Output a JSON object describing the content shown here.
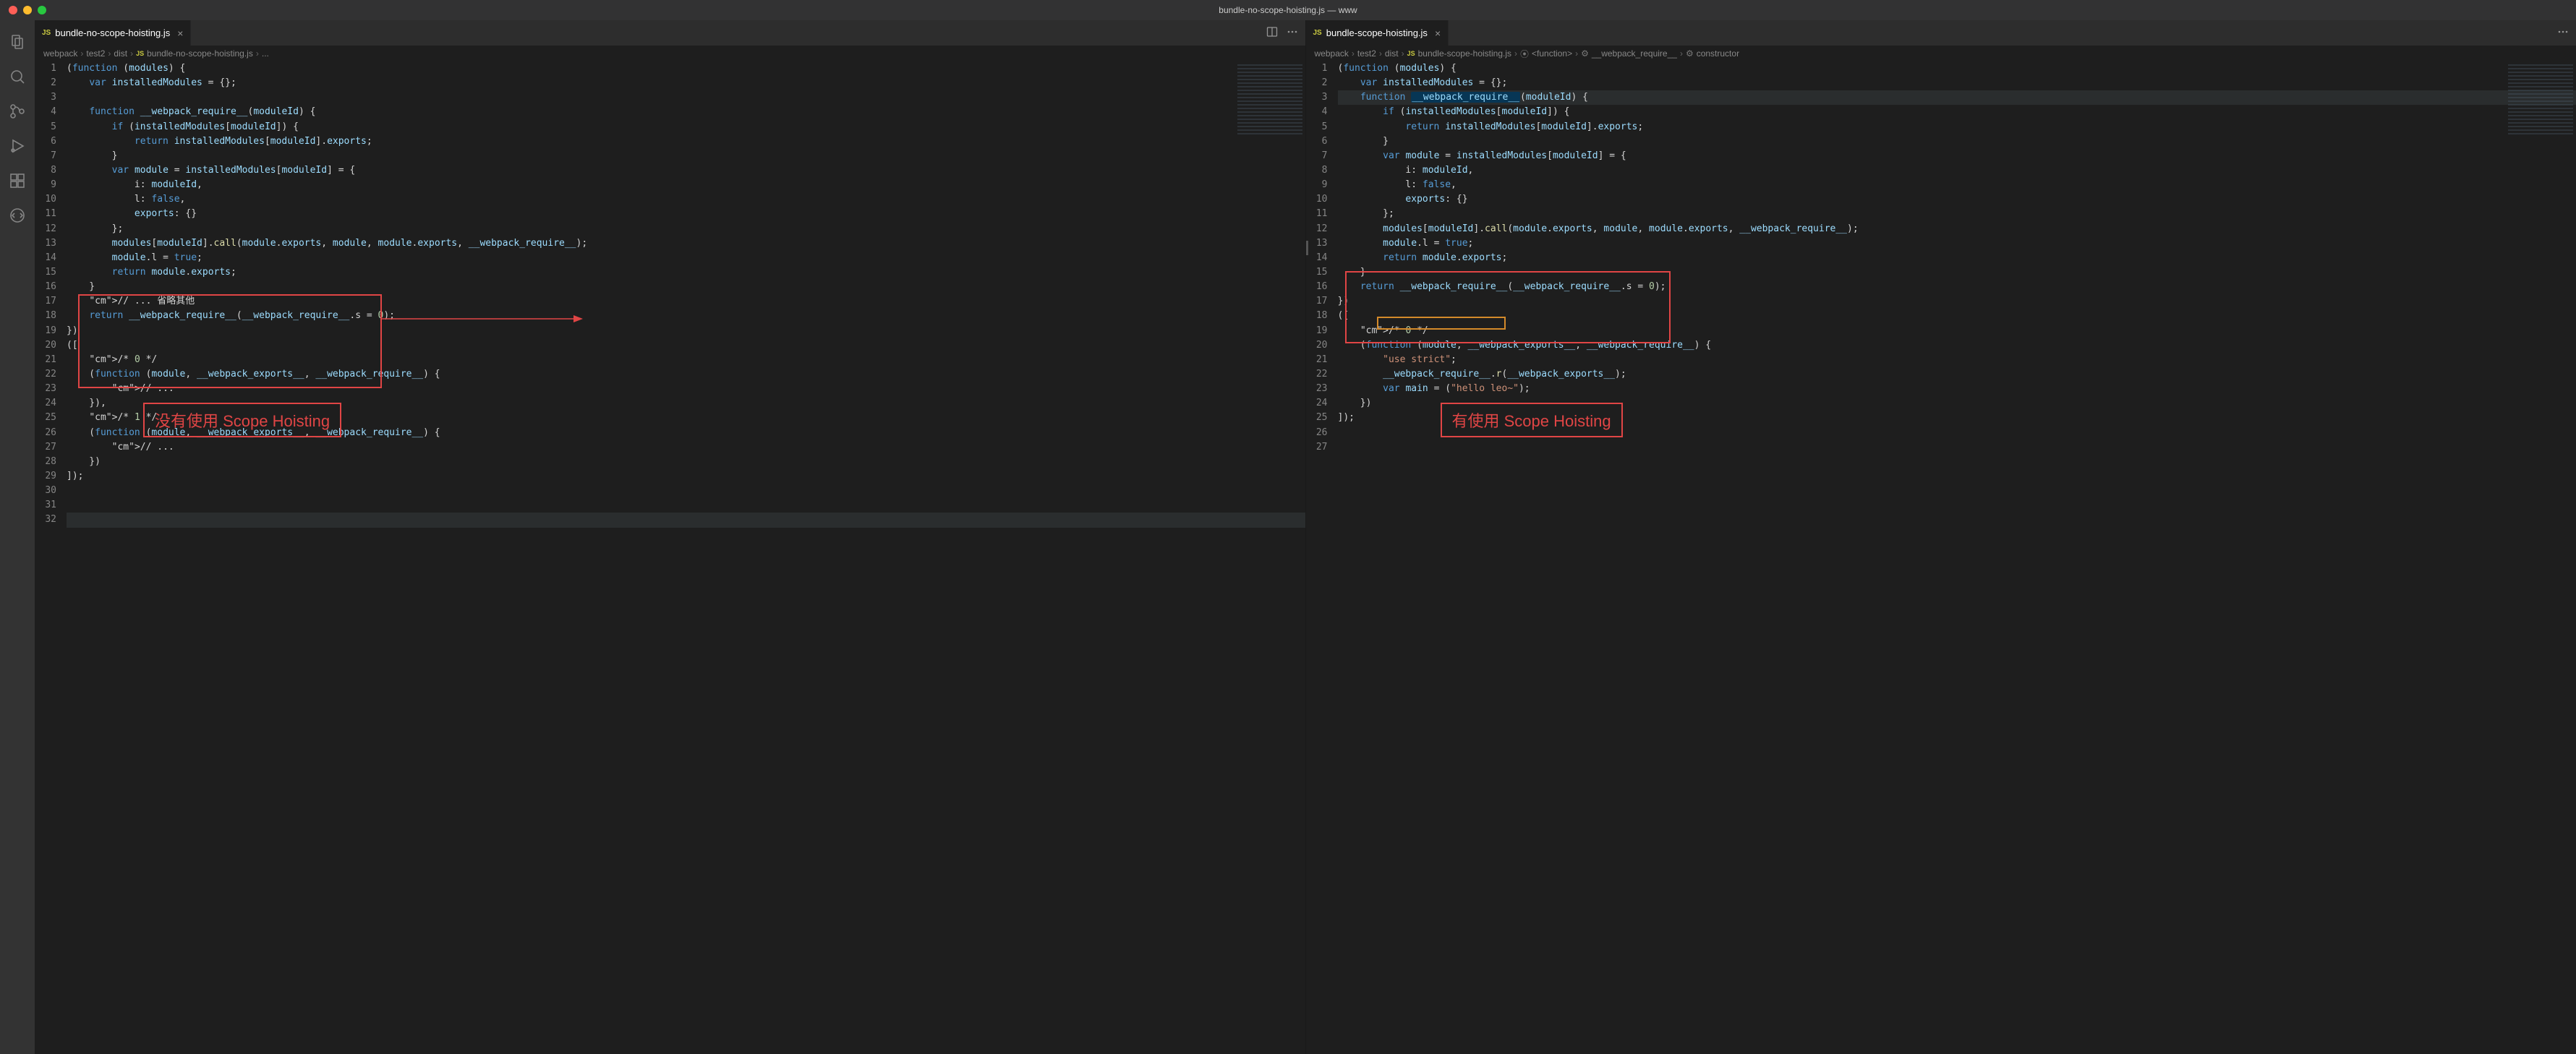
{
  "window": {
    "title": "bundle-no-scope-hoisting.js — www"
  },
  "activitybar": {
    "items": [
      {
        "name": "explorer-icon"
      },
      {
        "name": "search-icon"
      },
      {
        "name": "source-control-icon"
      },
      {
        "name": "debug-icon"
      },
      {
        "name": "extensions-icon"
      },
      {
        "name": "live-share-icon"
      }
    ]
  },
  "left": {
    "tab_label": "bundle-no-scope-hoisting.js",
    "breadcrumbs": [
      "webpack",
      "test2",
      "dist",
      "bundle-no-scope-hoisting.js",
      "..."
    ],
    "line_numbers": [
      "1",
      "2",
      "3",
      "4",
      "5",
      "6",
      "7",
      "8",
      "9",
      "10",
      "11",
      "12",
      "13",
      "14",
      "15",
      "16",
      "17",
      "18",
      "19",
      "20",
      "21",
      "22",
      "23",
      "24",
      "25",
      "26",
      "27",
      "28",
      "29",
      "30",
      "31",
      "32"
    ],
    "lines": {
      "l1": "(function (modules) {",
      "l2": "    var installedModules = {};",
      "l3": "",
      "l4": "    function __webpack_require__(moduleId) {",
      "l5": "        if (installedModules[moduleId]) {",
      "l6": "            return installedModules[moduleId].exports;",
      "l7": "        }",
      "l8": "        var module = installedModules[moduleId] = {",
      "l9": "            i: moduleId,",
      "l10": "            l: false,",
      "l11": "            exports: {}",
      "l12": "        };",
      "l13": "        modules[moduleId].call(module.exports, module, module.exports, __webpack_require__);",
      "l14": "        module.l = true;",
      "l15": "        return module.exports;",
      "l16": "    }",
      "l17": "    // ... 省略其他",
      "l18": "    return __webpack_require__(__webpack_require__.s = 0);",
      "l19": "})",
      "l20": "([",
      "l21": "    /* 0 */",
      "l22": "    (function (module, __webpack_exports__, __webpack_require__) {",
      "l23": "        // ...",
      "l24": "    }),",
      "l25": "    /* 1 */",
      "l26": "    (function (module, __webpack_exports__, __webpack_require__) {",
      "l27": "        // ...",
      "l28": "    })",
      "l29": "]);",
      "l30": "",
      "l31": "",
      "l32": ""
    },
    "annotation_label": "没有使用 Scope Hoisting"
  },
  "right": {
    "tab_label": "bundle-scope-hoisting.js",
    "breadcrumbs": [
      "webpack",
      "test2",
      "dist",
      "bundle-scope-hoisting.js",
      "<function>",
      "__webpack_require__",
      "constructor"
    ],
    "line_numbers": [
      "1",
      "2",
      "3",
      "4",
      "5",
      "6",
      "7",
      "8",
      "9",
      "10",
      "11",
      "12",
      "13",
      "14",
      "15",
      "16",
      "17",
      "18",
      "19",
      "20",
      "21",
      "22",
      "23",
      "24",
      "25",
      "26",
      "27"
    ],
    "lines": {
      "l1": "(function (modules) {",
      "l2": "    var installedModules = {};",
      "l3": "    function __webpack_require__(moduleId) {",
      "l4": "        if (installedModules[moduleId]) {",
      "l5": "            return installedModules[moduleId].exports;",
      "l6": "        }",
      "l7": "        var module = installedModules[moduleId] = {",
      "l8": "            i: moduleId,",
      "l9": "            l: false,",
      "l10": "            exports: {}",
      "l11": "        };",
      "l12": "        modules[moduleId].call(module.exports, module, module.exports, __webpack_require__);",
      "l13": "        module.l = true;",
      "l14": "        return module.exports;",
      "l15": "    }",
      "l16": "    return __webpack_require__(__webpack_require__.s = 0);",
      "l17": "})",
      "l18": "([",
      "l19": "    /* 0 */",
      "l20": "    (function (module, __webpack_exports__, __webpack_require__) {",
      "l21": "        \"use strict\";",
      "l22": "        __webpack_require__.r(__webpack_exports__);",
      "l23": "        var main = (\"hello leo~\");",
      "l24": "    })",
      "l25": "]);",
      "l26": "",
      "l27": ""
    },
    "annotation_label": "有使用 Scope Hoisting"
  },
  "icons": {
    "js": "JS",
    "split": "split-editor-icon",
    "more": "more-icon",
    "close": "close-icon"
  }
}
